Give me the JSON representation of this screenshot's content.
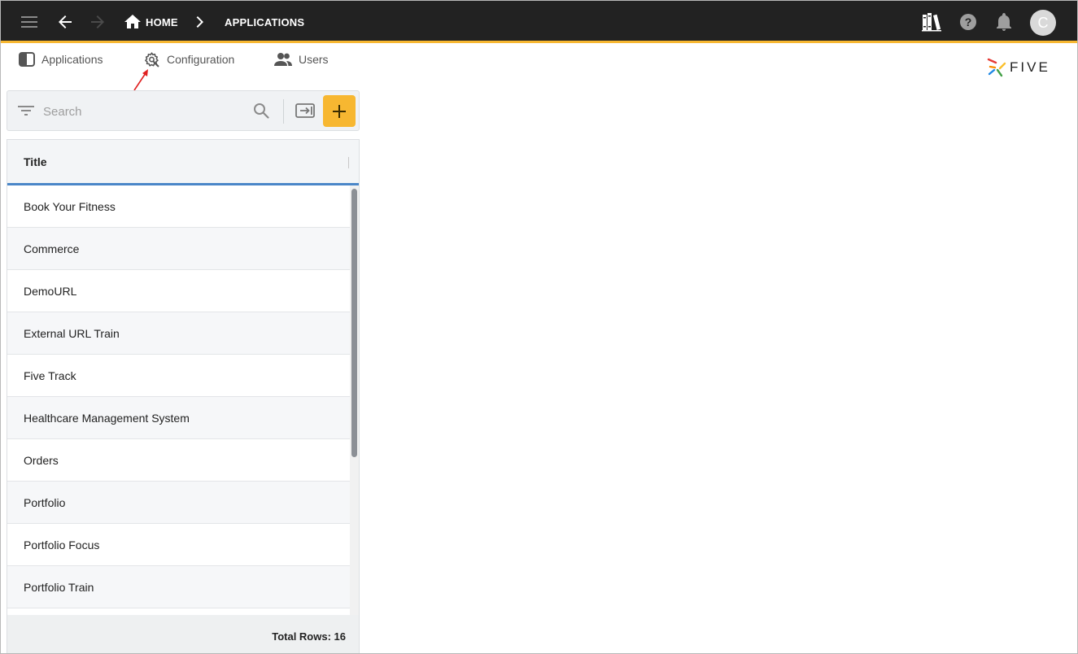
{
  "topbar": {
    "menu_icon": "hamburger-menu-icon",
    "back_icon": "arrow-left-icon",
    "forward_icon": "arrow-right-icon",
    "breadcrumb": [
      {
        "label": "HOME",
        "icon": "home-icon"
      },
      {
        "label": "APPLICATIONS"
      }
    ],
    "right_icons": [
      "books-icon",
      "help-icon",
      "bell-icon"
    ],
    "avatar_initial": "C",
    "accent_color": "#f7b731",
    "background_color": "#222222"
  },
  "menu": {
    "tabs": [
      {
        "label": "Applications",
        "icon": "applications-icon"
      },
      {
        "label": "Configuration",
        "icon": "gear-wrench-icon"
      },
      {
        "label": "Users",
        "icon": "users-icon"
      }
    ]
  },
  "logo": {
    "text": "FIVE"
  },
  "search": {
    "placeholder": "Search",
    "value": "",
    "filter_icon": "filter-icon",
    "search_icon": "search-icon",
    "import_icon": "import-icon",
    "add_icon": "plus-icon"
  },
  "table": {
    "column_header": "Title",
    "rows": [
      "Book Your Fitness",
      "Commerce",
      "DemoURL",
      "External URL Train",
      "Five Track",
      "Healthcare Management System",
      "Orders",
      "Portfolio",
      "Portfolio Focus",
      "Portfolio Train"
    ],
    "footer": "Total Rows: 16"
  }
}
